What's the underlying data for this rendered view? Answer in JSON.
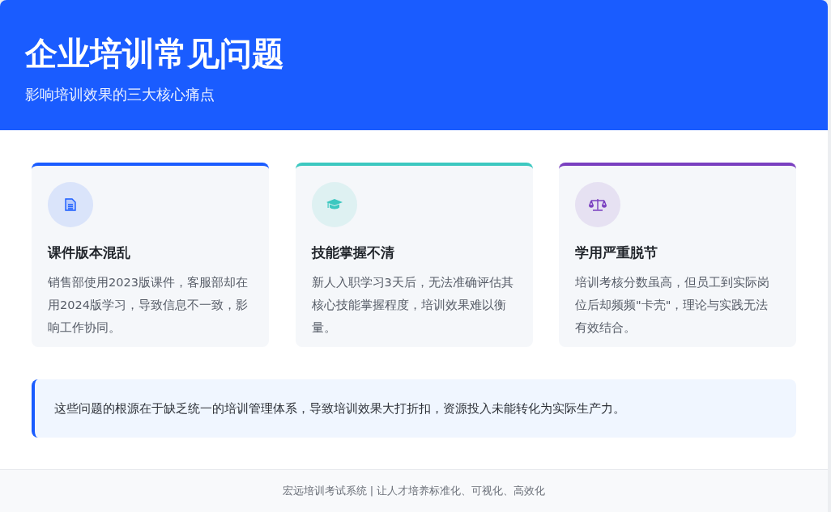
{
  "header": {
    "title": "企业培训常见问题",
    "subtitle": "影响培训效果的三大核心痛点"
  },
  "cards": [
    {
      "kind": "document",
      "color": "#1a5cff",
      "title": "课件版本混乱",
      "text": "销售部使用2023版课件，客服部却在用2024版学习，导致信息不一致，影响工作协同。"
    },
    {
      "kind": "graduation-cap",
      "color": "#3cc8c0",
      "title": "技能掌握不清",
      "text": "新人入职学习3天后，无法准确评估其核心技能掌握程度，培训效果难以衡量。"
    },
    {
      "kind": "scale",
      "color": "#7a3fc0",
      "title": "学用严重脱节",
      "text": "培训考核分数虽高，但员工到实际岗位后却频频\"卡壳\"，理论与实践无法有效结合。"
    }
  ],
  "summary": "这些问题的根源在于缺乏统一的培训管理体系，导致培训效果大打折扣，资源投入未能转化为实际生产力。",
  "footer": "宏远培训考试系统 | 让人才培养标准化、可视化、高效化"
}
